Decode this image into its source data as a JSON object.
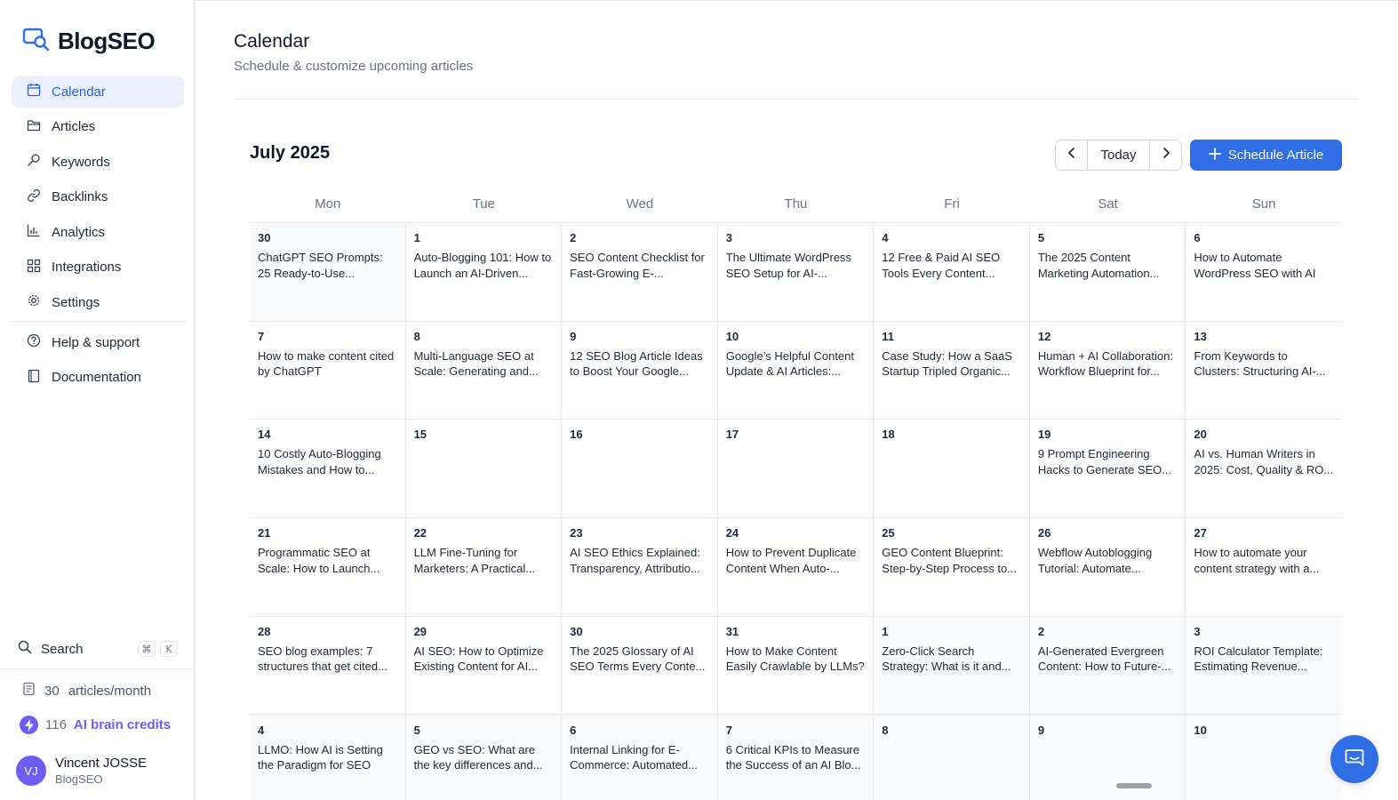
{
  "app": {
    "name": "BlogSEO"
  },
  "sidebar": {
    "items": [
      {
        "label": "Calendar",
        "icon": "calendar-icon",
        "active": true
      },
      {
        "label": "Articles",
        "icon": "folder-icon"
      },
      {
        "label": "Keywords",
        "icon": "key-icon"
      },
      {
        "label": "Backlinks",
        "icon": "link-icon"
      },
      {
        "label": "Analytics",
        "icon": "bar-chart-icon"
      },
      {
        "label": "Integrations",
        "icon": "grid-icon"
      },
      {
        "label": "Settings",
        "icon": "gear-icon"
      }
    ],
    "secondary": [
      {
        "label": "Help & support",
        "icon": "help-icon"
      },
      {
        "label": "Documentation",
        "icon": "book-icon"
      }
    ],
    "search": {
      "label": "Search",
      "shortcut_mod": "⌘",
      "shortcut_key": "K"
    },
    "articles_month": {
      "value": "30",
      "label": "articles/month"
    },
    "credits": {
      "value": "116",
      "label": "AI brain credits"
    },
    "user": {
      "initials": "VJ",
      "name": "Vincent JOSSE",
      "org": "BlogSEO"
    }
  },
  "header": {
    "title": "Calendar",
    "subtitle": "Schedule & customize upcoming articles"
  },
  "calendar": {
    "month": "July 2025",
    "today_label": "Today",
    "schedule_label": "Schedule Article",
    "weekdays": [
      "Mon",
      "Tue",
      "Wed",
      "Thu",
      "Fri",
      "Sat",
      "Sun"
    ],
    "weeks": [
      [
        {
          "day": "30",
          "title": "ChatGPT SEO Prompts: 25 Ready-to-Use...",
          "muted": true
        },
        {
          "day": "1",
          "title": "Auto-Blogging 101: How to Launch an AI-Driven..."
        },
        {
          "day": "2",
          "title": "SEO Content Checklist for Fast-Growing E-..."
        },
        {
          "day": "3",
          "title": "The Ultimate WordPress SEO Setup for AI-..."
        },
        {
          "day": "4",
          "title": "12 Free & Paid AI SEO Tools Every Content..."
        },
        {
          "day": "5",
          "title": "The 2025 Content Marketing Automation..."
        },
        {
          "day": "6",
          "title": "How to Automate WordPress SEO with AI"
        }
      ],
      [
        {
          "day": "7",
          "title": "How to make content cited by ChatGPT"
        },
        {
          "day": "8",
          "title": "Multi-Language SEO at Scale: Generating and..."
        },
        {
          "day": "9",
          "title": "12 SEO Blog Article Ideas to Boost Your Google..."
        },
        {
          "day": "10",
          "title": "Google’s Helpful Content Update & AI Articles:..."
        },
        {
          "day": "11",
          "title": "Case Study: How a SaaS Startup Tripled Organic..."
        },
        {
          "day": "12",
          "title": "Human + AI Collaboration: Workflow Blueprint for..."
        },
        {
          "day": "13",
          "title": "From Keywords to Clusters: Structuring AI-..."
        }
      ],
      [
        {
          "day": "14",
          "title": "10 Costly Auto-Blogging Mistakes and How to..."
        },
        {
          "day": "15",
          "title": ""
        },
        {
          "day": "16",
          "title": ""
        },
        {
          "day": "17",
          "title": ""
        },
        {
          "day": "18",
          "title": ""
        },
        {
          "day": "19",
          "title": "9 Prompt Engineering Hacks to Generate SEO..."
        },
        {
          "day": "20",
          "title": "AI vs. Human Writers in 2025: Cost, Quality & RO..."
        }
      ],
      [
        {
          "day": "21",
          "title": "Programmatic SEO at Scale: How to Launch..."
        },
        {
          "day": "22",
          "title": "LLM Fine-Tuning for Marketers: A Practical..."
        },
        {
          "day": "23",
          "title": "AI SEO Ethics Explained: Transparency, Attributio..."
        },
        {
          "day": "24",
          "title": "How to Prevent Duplicate Content When Auto-..."
        },
        {
          "day": "25",
          "title": "GEO Content Blueprint: Step-by-Step Process to..."
        },
        {
          "day": "26",
          "title": "Webflow Autoblogging Tutorial: Automate..."
        },
        {
          "day": "27",
          "title": "How to automate your content strategy with a..."
        }
      ],
      [
        {
          "day": "28",
          "title": "SEO blog examples: 7 structures that get cited..."
        },
        {
          "day": "29",
          "title": "AI SEO: How to Optimize Existing Content for AI..."
        },
        {
          "day": "30",
          "title": "The 2025 Glossary of AI SEO Terms Every Conte..."
        },
        {
          "day": "31",
          "title": "How to Make Content Easily Crawlable by LLMs?"
        },
        {
          "day": "1",
          "title": "Zero-Click Search Strategy: What is it and...",
          "muted": true
        },
        {
          "day": "2",
          "title": "AI-Generated Evergreen Content: How to Future-...",
          "muted": true
        },
        {
          "day": "3",
          "title": "ROI Calculator Template: Estimating Revenue...",
          "muted": true
        }
      ],
      [
        {
          "day": "4",
          "title": "LLMO: How AI is Setting the Paradigm for SEO",
          "muted": true
        },
        {
          "day": "5",
          "title": "GEO vs SEO: What are the key differences and...",
          "muted": true
        },
        {
          "day": "6",
          "title": "Internal Linking for E-Commerce: Automated...",
          "muted": true
        },
        {
          "day": "7",
          "title": "6 Critical KPIs to Measure the Success of an AI Blo...",
          "muted": true
        },
        {
          "day": "8",
          "title": "",
          "muted": true
        },
        {
          "day": "9",
          "title": "",
          "muted": true
        },
        {
          "day": "10",
          "title": "",
          "muted": true
        }
      ]
    ]
  },
  "colors": {
    "accent": "#2f6ee5",
    "credits": "#6d5cf6",
    "active_bg": "#eaf1fd"
  }
}
